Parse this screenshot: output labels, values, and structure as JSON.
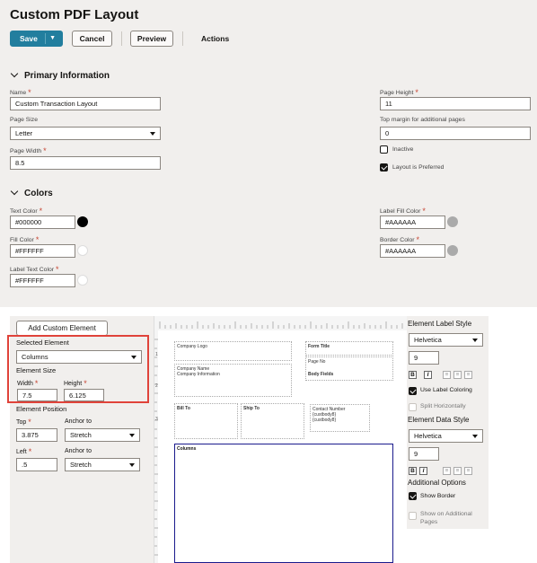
{
  "page_title": "Custom PDF Layout",
  "toolbar": {
    "save": "Save",
    "cancel": "Cancel",
    "preview": "Preview",
    "actions": "Actions"
  },
  "primary": {
    "header": "Primary Information",
    "name_label": "Name",
    "name_value": "Custom Transaction Layout",
    "page_size_label": "Page Size",
    "page_size_value": "Letter",
    "page_width_label": "Page Width",
    "page_width_value": "8.5",
    "page_height_label": "Page Height",
    "page_height_value": "11",
    "top_margin_label": "Top margin for additional pages",
    "top_margin_value": "0",
    "inactive_label": "Inactive",
    "inactive_checked": false,
    "preferred_label": "Layout is Preferred",
    "preferred_checked": true
  },
  "colors": {
    "header": "Colors",
    "text_color_label": "Text Color",
    "text_color_value": "#000000",
    "text_color_swatch": "#000000",
    "fill_color_label": "Fill Color",
    "fill_color_value": "#FFFFFF",
    "fill_color_swatch": "#FFFFFF",
    "label_text_color_label": "Label Text Color",
    "label_text_color_value": "#FFFFFF",
    "label_text_color_swatch": "#FFFFFF",
    "label_fill_color_label": "Label Fill Color",
    "label_fill_color_value": "#AAAAAA",
    "label_fill_color_swatch": "#AAAAAA",
    "border_color_label": "Border Color",
    "border_color_value": "#AAAAAA",
    "border_color_swatch": "#AAAAAA"
  },
  "editor": {
    "add_element": "Add Custom Element",
    "selected_element_label": "Selected Element",
    "selected_element_value": "Columns",
    "element_size_label": "Element Size",
    "width_label": "Width",
    "width_value": "7.5",
    "height_label": "Height",
    "height_value": "6.125",
    "element_position_label": "Element Position",
    "top_label": "Top",
    "top_value": "3.875",
    "anchor_to_label": "Anchor to",
    "anchor_top_value": "Stretch",
    "left_label": "Left",
    "left_value": ".5",
    "anchor_left_value": "Stretch"
  },
  "canvas": {
    "company_logo": "Company Logo",
    "company_name": "Company Name",
    "company_info": "Company Information",
    "form_title": "Form Title",
    "page_no": "Page No",
    "body_fields": "Body Fields",
    "bill_to": "Bill To",
    "ship_to": "Ship To",
    "contact_number": "Contact Number",
    "custbody8a": "{custbody8}",
    "custbody8b": "{custbody8}",
    "columns": "Columns",
    "ruler_left": [
      "1",
      "2",
      "3"
    ]
  },
  "style_panel": {
    "label_style_header": "Element Label Style",
    "label_font": "Helvetica",
    "label_size": "9",
    "use_label_coloring": "Use Label Coloring",
    "use_label_coloring_checked": true,
    "split_horizontally": "Split Horizontally",
    "split_horizontally_checked": false,
    "data_style_header": "Element Data Style",
    "data_font": "Helvetica",
    "data_size": "9",
    "additional_options": "Additional Options",
    "show_border": "Show Border",
    "show_border_checked": true,
    "show_on_additional": "Show on Additional Pages",
    "show_on_additional_checked": false,
    "bold_glyph": "B",
    "italic_glyph": "I"
  },
  "accent": {
    "primary": "#227e9e",
    "highlight": "#e0433a",
    "required": "#c74634",
    "column_border": "#1a1a8c"
  }
}
